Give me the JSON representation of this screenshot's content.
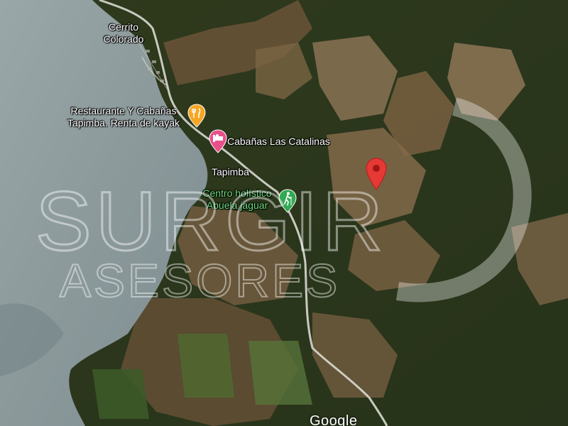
{
  "map": {
    "places": {
      "town_cerrito": [
        "Cerrito",
        "Colorado"
      ],
      "town_tapimba": "Tapimba"
    },
    "pois": [
      {
        "lines": [
          "Restaurante Y Cabañas",
          "Tapimba. Renta de kayak"
        ],
        "icon": "restaurant-icon",
        "color": "#f5a623"
      },
      {
        "lines": [
          "Cabañas Las Catalinas"
        ],
        "icon": "lodging-icon",
        "color": "#e8508a"
      },
      {
        "lines": [
          "Centro holístico",
          "Abuela jaguar"
        ],
        "icon": "hiking-icon",
        "color": "#34a853"
      }
    ],
    "marker": {
      "icon": "map-pin-icon",
      "color": "#e53935"
    },
    "watermark": {
      "line1": "SURGIR",
      "line2": "ASESORES"
    },
    "attribution": "Google"
  }
}
